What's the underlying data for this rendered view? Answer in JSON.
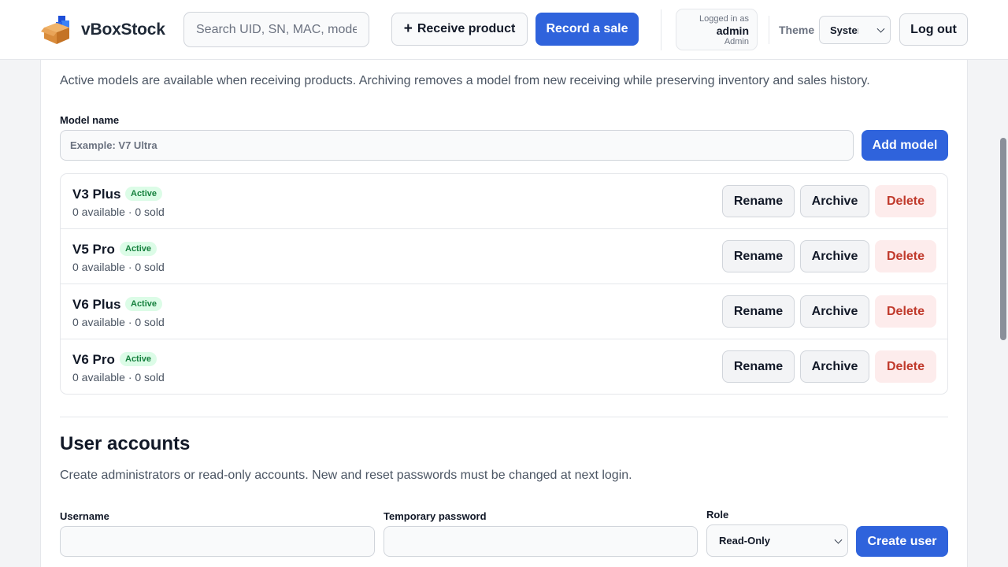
{
  "header": {
    "brand": "vBoxStock",
    "search_placeholder": "Search UID, SN, MAC, model",
    "receive_label": "Receive product",
    "record_label": "Record a sale",
    "user": {
      "logged_in_as": "Logged in as",
      "username": "admin",
      "role": "Admin"
    },
    "theme_label": "Theme",
    "theme_value": "System",
    "logout_label": "Log out"
  },
  "models": {
    "description": "Active models are available when receiving products. Archiving removes a model from new receiving while preserving inventory and sales history.",
    "field_label": "Model name",
    "placeholder": "Example: V7 Ultra",
    "add_label": "Add model",
    "items": [
      {
        "name": "V3 Plus",
        "status": "Active",
        "meta": "0 available · 0 sold"
      },
      {
        "name": "V5 Pro",
        "status": "Active",
        "meta": "0 available · 0 sold"
      },
      {
        "name": "V6 Plus",
        "status": "Active",
        "meta": "0 available · 0 sold"
      },
      {
        "name": "V6 Pro",
        "status": "Active",
        "meta": "0 available · 0 sold"
      }
    ],
    "rename_label": "Rename",
    "archive_label": "Archive",
    "delete_label": "Delete"
  },
  "users": {
    "title": "User accounts",
    "description": "Create administrators or read-only accounts. New and reset passwords must be changed at next login.",
    "username_label": "Username",
    "password_label": "Temporary password",
    "role_label": "Role",
    "role_value": "Read-Only",
    "create_label": "Create user"
  },
  "colors": {
    "primary": "#2f63dc",
    "success_bg": "#dcfce7",
    "success_text": "#15803d",
    "danger_bg": "#fdecec",
    "danger_text": "#c0392b"
  }
}
